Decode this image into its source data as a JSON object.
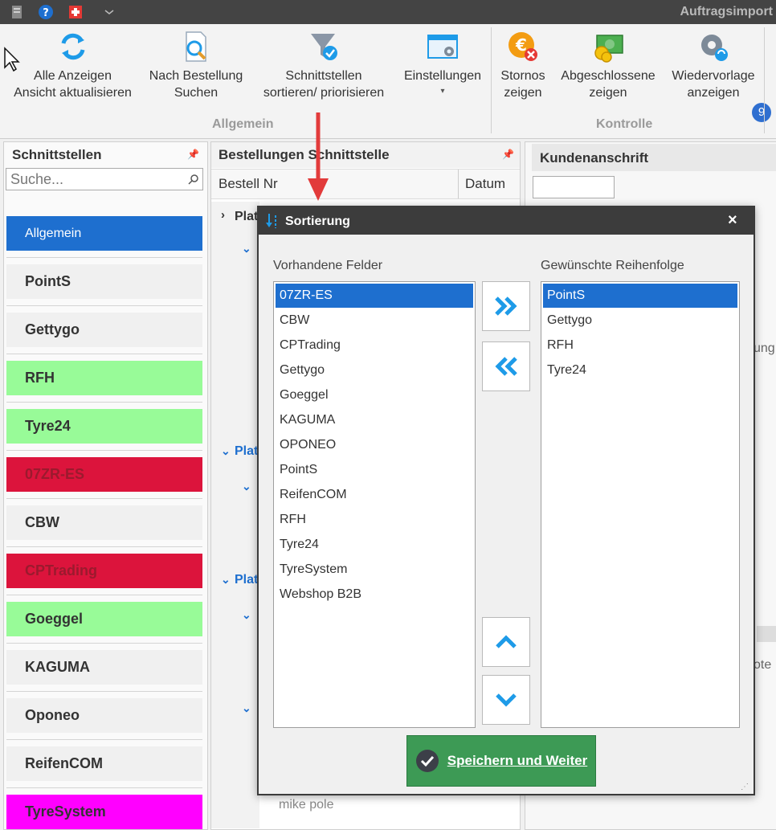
{
  "window": {
    "title": "Auftragsimport"
  },
  "ribbon": {
    "buttons": {
      "alle": "Alle Anzeigen\nAnsicht aktualisieren",
      "nach": "Nach Bestellung\nSuchen",
      "sortieren": "Schnittstellen\nsortieren/ priorisieren",
      "einstellungen": "Einstellungen",
      "stornos": "Stornos\nzeigen",
      "abgeschlossene": "Abgeschlossene\nzeigen",
      "wiedervorlage": "Wiedervorlage\nanzeigen"
    },
    "groups": {
      "allgemein": "Allgemein",
      "kontrolle": "Kontrolle"
    },
    "badge": "9"
  },
  "left_panel": {
    "title": "Schnittstellen",
    "search_placeholder": "Suche...",
    "items": [
      {
        "label": "Allgemein",
        "bg": "#1e6fcf",
        "fg": "#ffffff",
        "bold": false
      },
      {
        "label": "PointS",
        "bg": "#f0f0f0",
        "fg": "#333333",
        "bold": true
      },
      {
        "label": "Gettygo",
        "bg": "#f0f0f0",
        "fg": "#333333",
        "bold": true
      },
      {
        "label": "RFH",
        "bg": "#98fb98",
        "fg": "#333333",
        "bold": true
      },
      {
        "label": "Tyre24",
        "bg": "#98fb98",
        "fg": "#333333",
        "bold": true
      },
      {
        "label": "07ZR-ES",
        "bg": "#dc143c",
        "fg": "#9b1a2e",
        "bold": true
      },
      {
        "label": "CBW",
        "bg": "#f0f0f0",
        "fg": "#333333",
        "bold": true
      },
      {
        "label": "CPTrading",
        "bg": "#dc143c",
        "fg": "#9b1a2e",
        "bold": true
      },
      {
        "label": "Goeggel",
        "bg": "#98fb98",
        "fg": "#333333",
        "bold": true
      },
      {
        "label": "KAGUMA",
        "bg": "#f0f0f0",
        "fg": "#333333",
        "bold": true
      },
      {
        "label": "Oponeo",
        "bg": "#f0f0f0",
        "fg": "#333333",
        "bold": true
      },
      {
        "label": "ReifenCOM",
        "bg": "#f0f0f0",
        "fg": "#333333",
        "bold": true
      },
      {
        "label": "TyreSystem",
        "bg": "#ff00ff",
        "fg": "#333333",
        "bold": true
      }
    ]
  },
  "middle_panel": {
    "title": "Bestellungen Schnittstelle",
    "columns": [
      "Bestell Nr",
      "Datum"
    ],
    "group_label": "Plat",
    "visible_row": "mike pole"
  },
  "right_panel": {
    "title": "Kundenanschrift",
    "fragments": {
      "a": "ung",
      "b": "ote"
    }
  },
  "dialog": {
    "title": "Sortierung",
    "available_label": "Vorhandene Felder",
    "desired_label": "Gewünschte Reihenfolge",
    "available": [
      "07ZR-ES",
      "CBW",
      "CPTrading",
      "Gettygo",
      "Goeggel",
      "KAGUMA",
      "OPONEO",
      "PointS",
      "ReifenCOM",
      "RFH",
      "Tyre24",
      "TyreSystem",
      "Webshop B2B"
    ],
    "available_selected_index": 0,
    "desired": [
      "PointS",
      "Gettygo",
      "RFH",
      "Tyre24"
    ],
    "desired_selected_index": 0,
    "save_label": "Speichern und Weiter",
    "close_glyph": "×"
  },
  "colors": {
    "accent": "#1e6fcf",
    "save": "#3d9a55",
    "arrow": "#e23b3b"
  }
}
